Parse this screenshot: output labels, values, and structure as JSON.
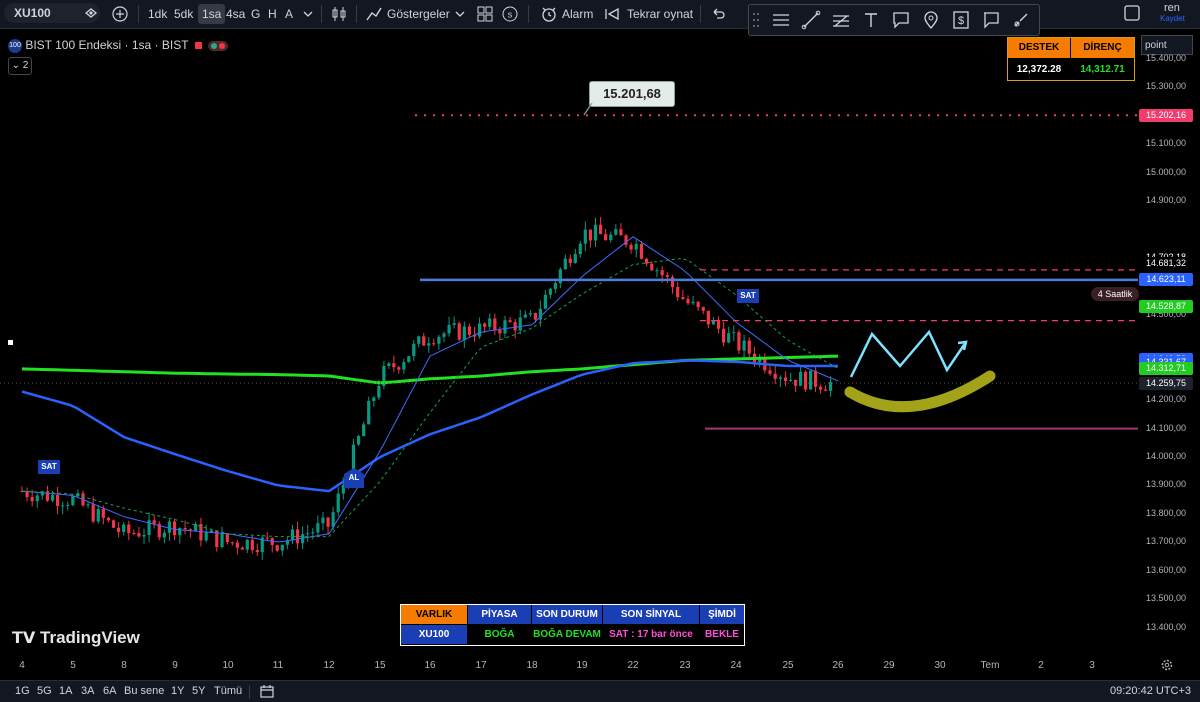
{
  "toolbar": {
    "symbol": "XU100",
    "timeframes": [
      "1dk",
      "5dk",
      "1sa",
      "4sa",
      "G",
      "H",
      "A"
    ],
    "indicators_label": "Göstergeler",
    "alarm_label": "Alarm",
    "replay_label": "Tekrar oynat",
    "user_name": "ren",
    "save_label": "Kaydet",
    "icons": [
      "menu-lines-icon",
      "trend-line-icon",
      "fib-icon",
      "text-tool-icon",
      "note-icon",
      "pin-icon",
      "price-tag-icon",
      "comment-icon",
      "brush-icon"
    ]
  },
  "legend": {
    "title": "BIST 100 Endeksi · 1sa · BIST",
    "collapsed_count": "2"
  },
  "support_resistance": {
    "support_label": "DESTEK",
    "resistance_label": "DİRENÇ",
    "support_value": "12,372.28",
    "resistance_value": "14,312.71"
  },
  "axis_select": "point",
  "callout": "15.201,68",
  "price_axis": {
    "ticks": [
      "15.400,00",
      "15.300,00",
      "15.100,00",
      "15.000,00",
      "14.900,00",
      "14.500,00",
      "14.200,00",
      "14.100,00",
      "14.000,00",
      "13.900,00",
      "13.800,00",
      "13.700,00",
      "13.600,00",
      "13.500,00",
      "13.400,00"
    ],
    "badges": [
      {
        "text": "15.202,16",
        "color": "#f23c6b"
      },
      {
        "text": "14.702,18",
        "color": "#000000"
      },
      {
        "text": "14.681,32",
        "color": "#000000"
      },
      {
        "text": "14.623,11",
        "color": "#2962ff"
      },
      {
        "text": "14.528,87",
        "color": "#22cc22"
      },
      {
        "text": "14.342,52",
        "color": "#2962ff"
      },
      {
        "text": "14.331,67",
        "color": "#2962ff"
      },
      {
        "text": "14.312,71",
        "color": "#22cc22"
      },
      {
        "text": "14.259,75",
        "color": "#1e222d"
      }
    ],
    "tag_4h": "4 Saatlik"
  },
  "time_axis": [
    "4",
    "5",
    "8",
    "9",
    "10",
    "11",
    "12",
    "15",
    "16",
    "17",
    "18",
    "19",
    "22",
    "23",
    "24",
    "25",
    "26",
    "29",
    "30",
    "Tem",
    "2",
    "3"
  ],
  "signals": {
    "sell": "SAT",
    "buy": "AL"
  },
  "signal_table": {
    "headers": [
      "VARLIK",
      "PİYASA",
      "SON DURUM",
      "SON SİNYAL",
      "ŞİMDİ"
    ],
    "values": [
      "XU100",
      "BOĞA",
      "BOĞA DEVAM",
      "SAT : 17 bar önce",
      "BEKLE"
    ]
  },
  "watermark": "TradingView",
  "bottom": {
    "ranges": [
      "1G",
      "5G",
      "1A",
      "3A",
      "6A",
      "Bu sene",
      "1Y",
      "5Y",
      "Tümü"
    ],
    "clock": "09:20:42 UTC+3"
  },
  "chart_data": {
    "type": "line",
    "title": "BIST 100 Endeksi · 1sa · BIST",
    "x": [
      "4",
      "5",
      "8",
      "9",
      "10",
      "11",
      "12",
      "15",
      "16",
      "17",
      "18",
      "19",
      "22",
      "23",
      "24",
      "25",
      "26"
    ],
    "ylim": [
      13350,
      15450
    ],
    "series": [
      {
        "values": [
          13880,
          13850,
          13730,
          13760,
          13700,
          13700,
          13760,
          14280,
          14430,
          14450,
          14480,
          14790,
          14760,
          14550,
          14400,
          14280,
          14255
        ]
      },
      {
        "values": [
          14230,
          14180,
          14070,
          14010,
          13950,
          13900,
          13880,
          14000,
          14080,
          14140,
          14220,
          14290,
          14330,
          14340,
          14335,
          14320,
          14320
        ]
      },
      {
        "values": [
          14310,
          14305,
          14300,
          14295,
          14292,
          14290,
          14285,
          14260,
          14275,
          14285,
          14300,
          14310,
          14325,
          14340,
          14345,
          14350,
          14355
        ]
      }
    ],
    "levels": [
      15202.16,
      14623.11,
      14528.87,
      14100.0
    ],
    "grid": false
  }
}
